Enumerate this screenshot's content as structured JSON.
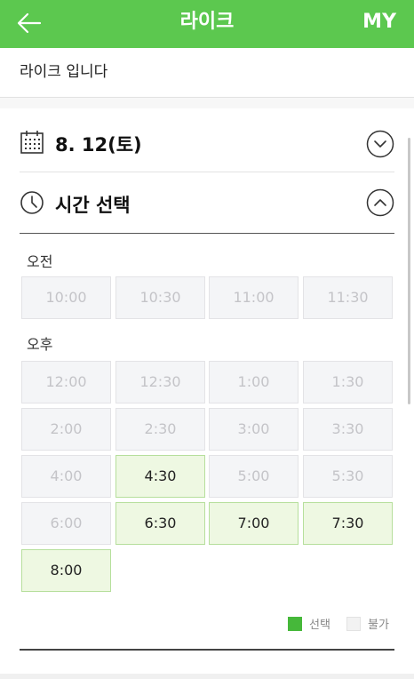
{
  "header": {
    "title": "라이크",
    "back_icon": "arrow-left-icon",
    "my_label": "MY",
    "color": "#5cc84f"
  },
  "subtitle": "라이크 입니다",
  "date_section": {
    "icon": "calendar-icon",
    "label": "8. 12(토)",
    "chevron": "chevron-down-circle-icon"
  },
  "time_section": {
    "icon": "clock-icon",
    "label": "시간 선택",
    "chevron": "chevron-up-circle-icon"
  },
  "morning": {
    "label": "오전",
    "slots": [
      {
        "time": "10:00",
        "available": false
      },
      {
        "time": "10:30",
        "available": false
      },
      {
        "time": "11:00",
        "available": false
      },
      {
        "time": "11:30",
        "available": false
      }
    ]
  },
  "afternoon": {
    "label": "오후",
    "slots": [
      {
        "time": "12:00",
        "available": false
      },
      {
        "time": "12:30",
        "available": false
      },
      {
        "time": "1:00",
        "available": false
      },
      {
        "time": "1:30",
        "available": false
      },
      {
        "time": "2:00",
        "available": false
      },
      {
        "time": "2:30",
        "available": false
      },
      {
        "time": "3:00",
        "available": false
      },
      {
        "time": "3:30",
        "available": false
      },
      {
        "time": "4:00",
        "available": false
      },
      {
        "time": "4:30",
        "available": true
      },
      {
        "time": "5:00",
        "available": false
      },
      {
        "time": "5:30",
        "available": false
      },
      {
        "time": "6:00",
        "available": false
      },
      {
        "time": "6:30",
        "available": true
      },
      {
        "time": "7:00",
        "available": true
      },
      {
        "time": "7:30",
        "available": true
      },
      {
        "time": "8:00",
        "available": true
      }
    ]
  },
  "legend": {
    "selected_label": "선택",
    "selected_color": "#46b83a",
    "unavailable_label": "불가",
    "unavailable_color": "#f2f2f2"
  }
}
